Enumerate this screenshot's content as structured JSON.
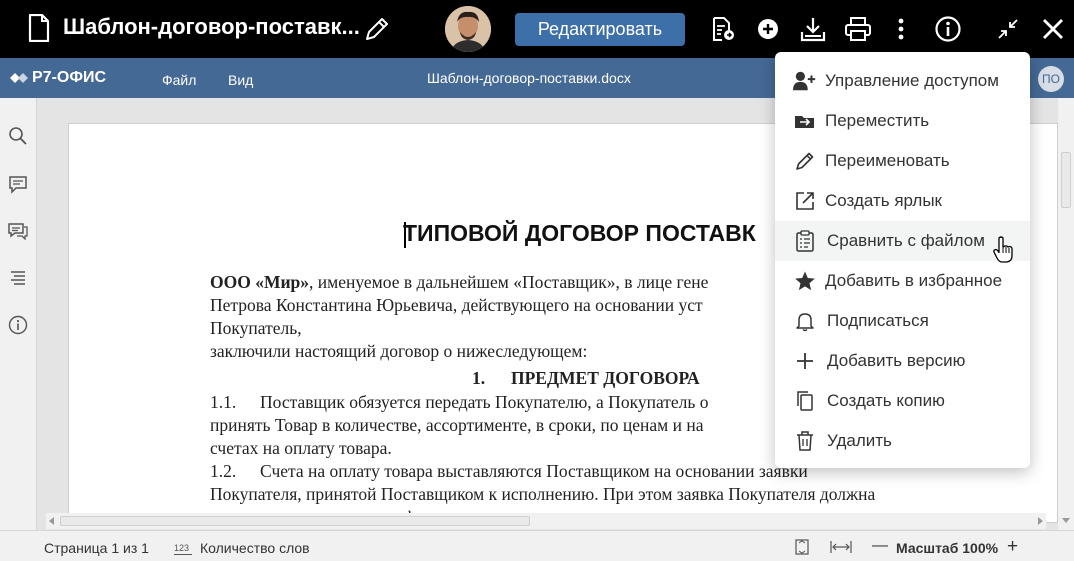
{
  "header": {
    "title": "Шаблон-договор-поставк...",
    "edit_label": "Редактировать"
  },
  "app": {
    "logo": "Р7-ОФИС",
    "menu": [
      "Файл",
      "Вид"
    ],
    "doc_name": "Шаблон-договор-поставки.docx",
    "user_initials": "ПО"
  },
  "document": {
    "heading": "ТИПОВОЙ ДОГОВОР ПОСТАВК",
    "line1_bold": "ООО «Мир»",
    "line1_rest": ", именуемое в дальнейшем «Поставщик», в лице гене",
    "line2": "Петрова Константина Юрьевича, действующего на основании уст",
    "line3": "Покупатель,",
    "line4": "заключили настоящий договор о нижеследующем:",
    "section_num": "1.",
    "section_title": "ПРЕДМЕТ ДОГОВОРА",
    "p11_num": "1.1.",
    "p11_text": "Поставщик обязуется передать Покупателю, а Покупатель о",
    "p11_line2": "принять Товар в количестве, ассортименте, в сроки, по ценам и на",
    "p11_line3": "счетах на оплату товара.",
    "p12_num": "1.2.",
    "p12_text": "Счета на оплату товара выставляются Поставщиком на основании заявки",
    "p12_line2": "Покупателя, принятой Поставщиком к исполнению. При этом заявка Покупателя должна",
    "p12_line3": "содержать следующую информацию: наименование, ассортимент, количество, срок"
  },
  "status": {
    "page": "Страница 1 из 1",
    "word_count": "Количество слов",
    "word_count_icon_text": "123",
    "zoom": "Масштаб 100%",
    "zoom_out": "—",
    "zoom_in": "+"
  },
  "menu": {
    "items": [
      {
        "label": "Управление доступом",
        "icon": "user-plus-icon"
      },
      {
        "label": "Переместить",
        "icon": "folder-move-icon"
      },
      {
        "label": "Переименовать",
        "icon": "pencil-icon"
      },
      {
        "label": "Создать ярлык",
        "icon": "external-link-icon"
      },
      {
        "label": "Сравнить с файлом",
        "icon": "clipboard-compare-icon"
      },
      {
        "label": "Добавить в избранное",
        "icon": "star-icon"
      },
      {
        "label": "Подписаться",
        "icon": "bell-icon"
      },
      {
        "label": "Добавить версию",
        "icon": "plus-icon"
      },
      {
        "label": "Создать копию",
        "icon": "copy-icon"
      },
      {
        "label": "Удалить",
        "icon": "trash-icon"
      }
    ]
  },
  "colors": {
    "topbar": "#000000",
    "appbar": "#446995",
    "edit_button": "#3d6fa8",
    "menu_hover": "#f3f4f4"
  }
}
